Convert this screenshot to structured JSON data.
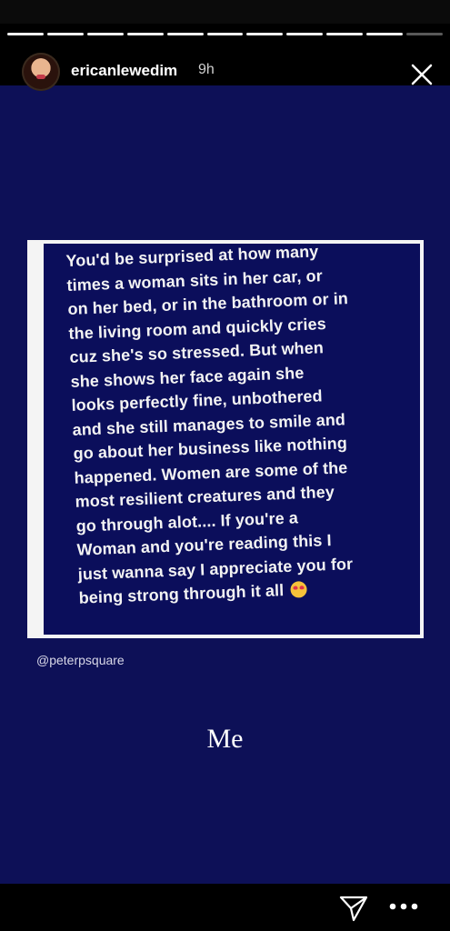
{
  "story": {
    "username": "ericanlewedim",
    "time_ago": "9h",
    "progress_segments": 11,
    "post_text_lines": [
      "You'd be surprised at how many",
      "times a woman sits in her car, or",
      "on her bed, or in the bathroom or in",
      "the living room and quickly cries",
      "cuz she's so stressed.  But when",
      "she shows her face again she",
      "looks perfectly fine, unbothered",
      "and she still manages to smile and",
      "go about her business like nothing",
      "happened.  Women are some of the",
      "most resilient creatures and they",
      "go through alot.... If you're a",
      "Woman and you're reading this I",
      "just wanna say I appreciate you for",
      "being strong through it all"
    ],
    "post_emoji": "heart-eyes-emoji",
    "source_tag": "@peterpsquare",
    "caption": "Me"
  },
  "icons": {
    "close": "close-icon",
    "send": "send-icon",
    "more": "more-options-icon"
  },
  "colors": {
    "story_background": "#0d1057",
    "quote_background": "#0b0e5b",
    "text": "#ffffff"
  }
}
